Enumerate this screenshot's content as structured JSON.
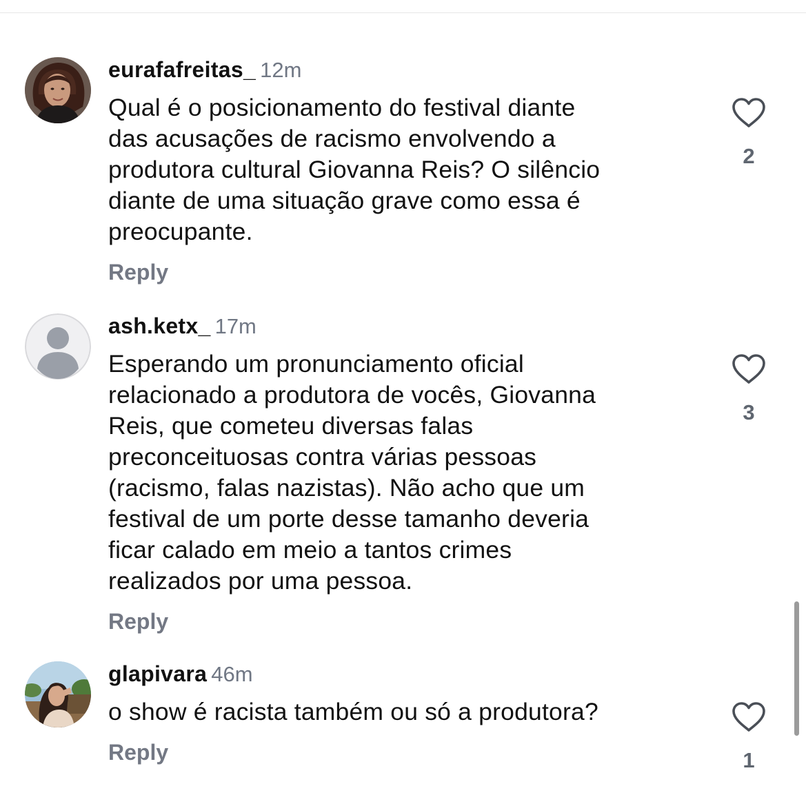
{
  "comments": [
    {
      "username": "eurafafreitas_",
      "time": "12m",
      "lines": [
        "Qual é o posicionamento do festival diante",
        "das acusações de racismo envolvendo a",
        "produtora cultural Giovanna Reis? O silêncio",
        "diante de uma situação grave como essa é",
        "preocupante."
      ],
      "reply_label": "Reply",
      "likes": "2",
      "avatar": "photo-woman-curly-hair"
    },
    {
      "username": "ash.ketx_",
      "time": "17m",
      "lines": [
        "Esperando um pronunciamento oficial",
        "relacionado a produtora de vocês, Giovanna",
        "Reis, que cometeu diversas falas",
        "preconceituosas contra várias pessoas",
        "(racismo, falas nazistas). Não acho que um",
        "festival de um porte desse tamanho deveria",
        "ficar calado em meio a tantos crimes",
        "realizados por uma pessoa."
      ],
      "reply_label": "Reply",
      "likes": "3",
      "avatar": "default-user-icon"
    },
    {
      "username": "glapivara",
      "time": "46m",
      "lines": [
        "o show é racista também ou só a produtora?"
      ],
      "reply_label": "Reply",
      "likes": "1",
      "avatar": "photo-woman-outdoors"
    }
  ],
  "icons": {
    "like": "heart-outline-icon"
  },
  "colors": {
    "username": "#111111",
    "timestamp": "#707784",
    "reply": "#737884",
    "like_count": "#5f6670",
    "heart_stroke": "#4a4f57"
  }
}
